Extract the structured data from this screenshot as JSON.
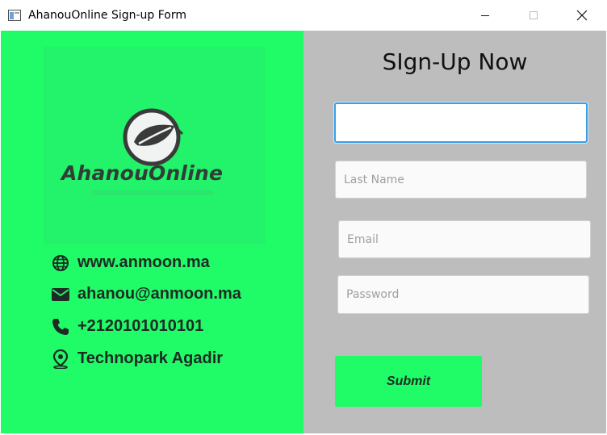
{
  "window": {
    "title": "AhanouOnline Sign-up Form",
    "icons": [
      "app-icon",
      "minimize-icon",
      "maximize-icon",
      "close-icon"
    ]
  },
  "brand": {
    "logo_text": "AhanouOnline",
    "logo_icon": "leaf-icon",
    "accent_color": "#1ffc68",
    "panel_color": "#bdbdbd"
  },
  "contact": [
    {
      "icon": "globe-icon",
      "text": "www.anmoon.ma"
    },
    {
      "icon": "envelope-icon",
      "text": "ahanou@anmoon.ma"
    },
    {
      "icon": "phone-icon",
      "text": "+2120101010101"
    },
    {
      "icon": "location-pin-icon",
      "text": "Technopark Agadir"
    }
  ],
  "form": {
    "heading": "SIgn-Up Now",
    "first_name": {
      "value": "",
      "placeholder": ""
    },
    "last_name": {
      "value": "",
      "placeholder": "Last Name"
    },
    "email": {
      "value": "",
      "placeholder": "Email"
    },
    "password": {
      "value": "",
      "placeholder": "Password"
    },
    "submit_label": "Submit"
  }
}
